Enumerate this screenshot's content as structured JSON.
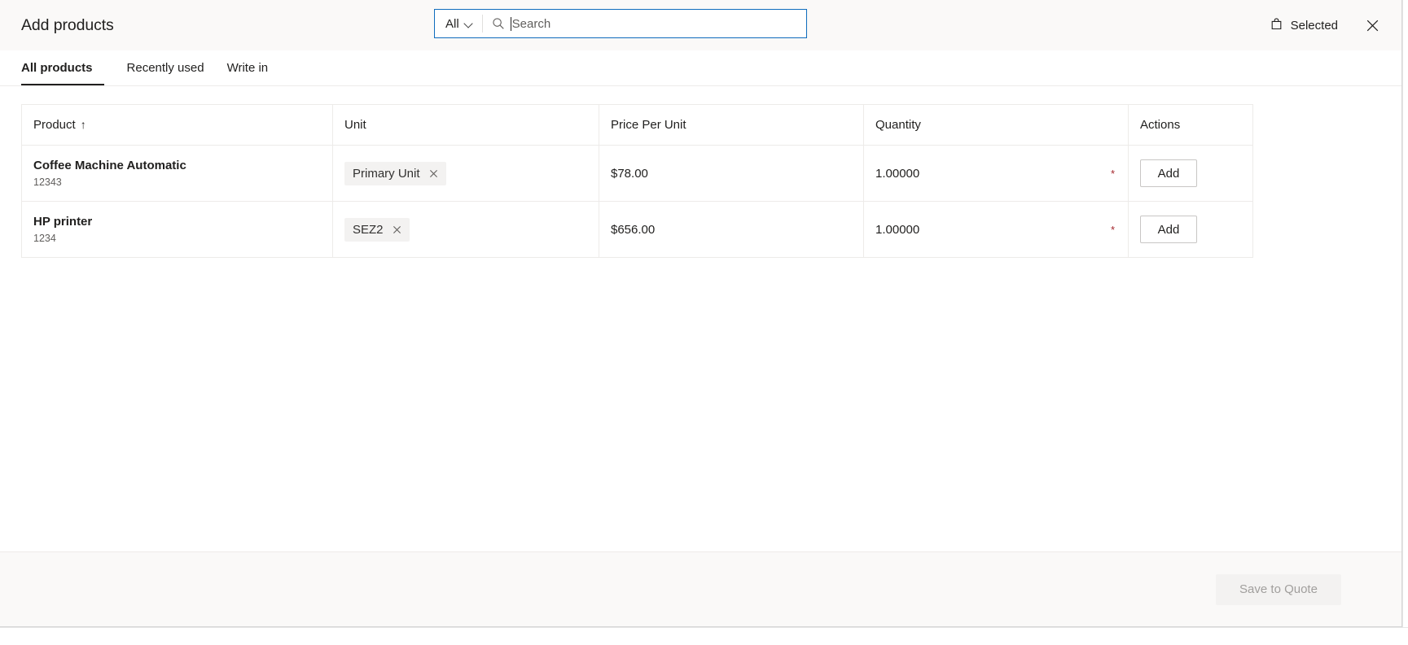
{
  "header": {
    "title": "Add products",
    "search": {
      "scope_label": "All",
      "scope_icon": "chevron-down-icon",
      "icon": "search-icon",
      "placeholder": "Search",
      "value": ""
    },
    "selected_label": "Selected",
    "selected_icon": "shopping-bag-icon",
    "close_icon": "close-icon"
  },
  "tabs": [
    {
      "label": "All products",
      "active": true
    },
    {
      "label": "Recently used",
      "active": false
    },
    {
      "label": "Write in",
      "active": false
    }
  ],
  "table": {
    "columns": [
      {
        "label": "Product",
        "sort": "↑"
      },
      {
        "label": "Unit",
        "sort": ""
      },
      {
        "label": "Price Per Unit",
        "sort": ""
      },
      {
        "label": "Quantity",
        "sort": ""
      },
      {
        "label": "Actions",
        "sort": ""
      }
    ],
    "rows": [
      {
        "product_name": "Coffee Machine Automatic",
        "product_code": "12343",
        "unit_chip": "Primary Unit",
        "unit_chip_remove_icon": "close-icon",
        "price": "$78.00",
        "quantity": "1.00000",
        "quantity_required_marker": "*",
        "action_label": "Add"
      },
      {
        "product_name": "HP printer",
        "product_code": "1234",
        "unit_chip": "SEZ2",
        "unit_chip_remove_icon": "close-icon",
        "price": "$656.00",
        "quantity": "1.00000",
        "quantity_required_marker": "*",
        "action_label": "Add"
      }
    ]
  },
  "footer": {
    "save_label": "Save to Quote",
    "save_disabled": true
  },
  "colors": {
    "accent_focus_border": "#0f6cbd",
    "header_bg": "#faf9f8",
    "required_star": "#a4262c",
    "chip_bg": "#f3f2f1",
    "grid_border": "#edebe9",
    "disabled_text": "#a19f9d"
  }
}
